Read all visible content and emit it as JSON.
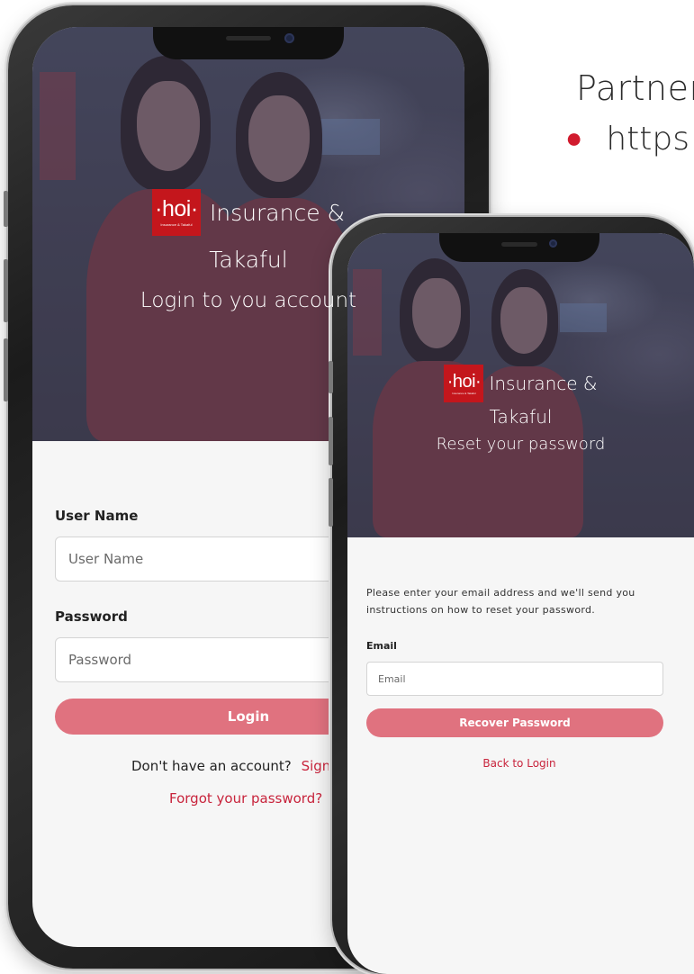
{
  "slide": {
    "heading": "Partners",
    "bullet_text": "https",
    "bullet_color": "#d11b2e"
  },
  "brand": {
    "logo_word": "·hoi·",
    "logo_tagline": "Insurance & Takaful",
    "name_line1": "Insurance &",
    "name_line2": "Takaful",
    "logo_color": "#c4161c"
  },
  "login_screen": {
    "subtitle": "Login to you account",
    "username_label": "User Name",
    "username_placeholder": "User Name",
    "password_label": "Password",
    "password_placeholder": "Password",
    "login_button": "Login",
    "no_account_text": "Don't have an account?",
    "signup_link": "Sign up",
    "forgot_link": "Forgot your password?"
  },
  "reset_screen": {
    "subtitle": "Reset your password",
    "instructions": "Please enter your email address and we'll send you instructions on how to reset your password.",
    "email_label": "Email",
    "email_placeholder": "Email",
    "recover_button": "Recover Password",
    "back_link": "Back to Login"
  },
  "colors": {
    "accent": "#e0727f",
    "link": "#c8243c"
  }
}
